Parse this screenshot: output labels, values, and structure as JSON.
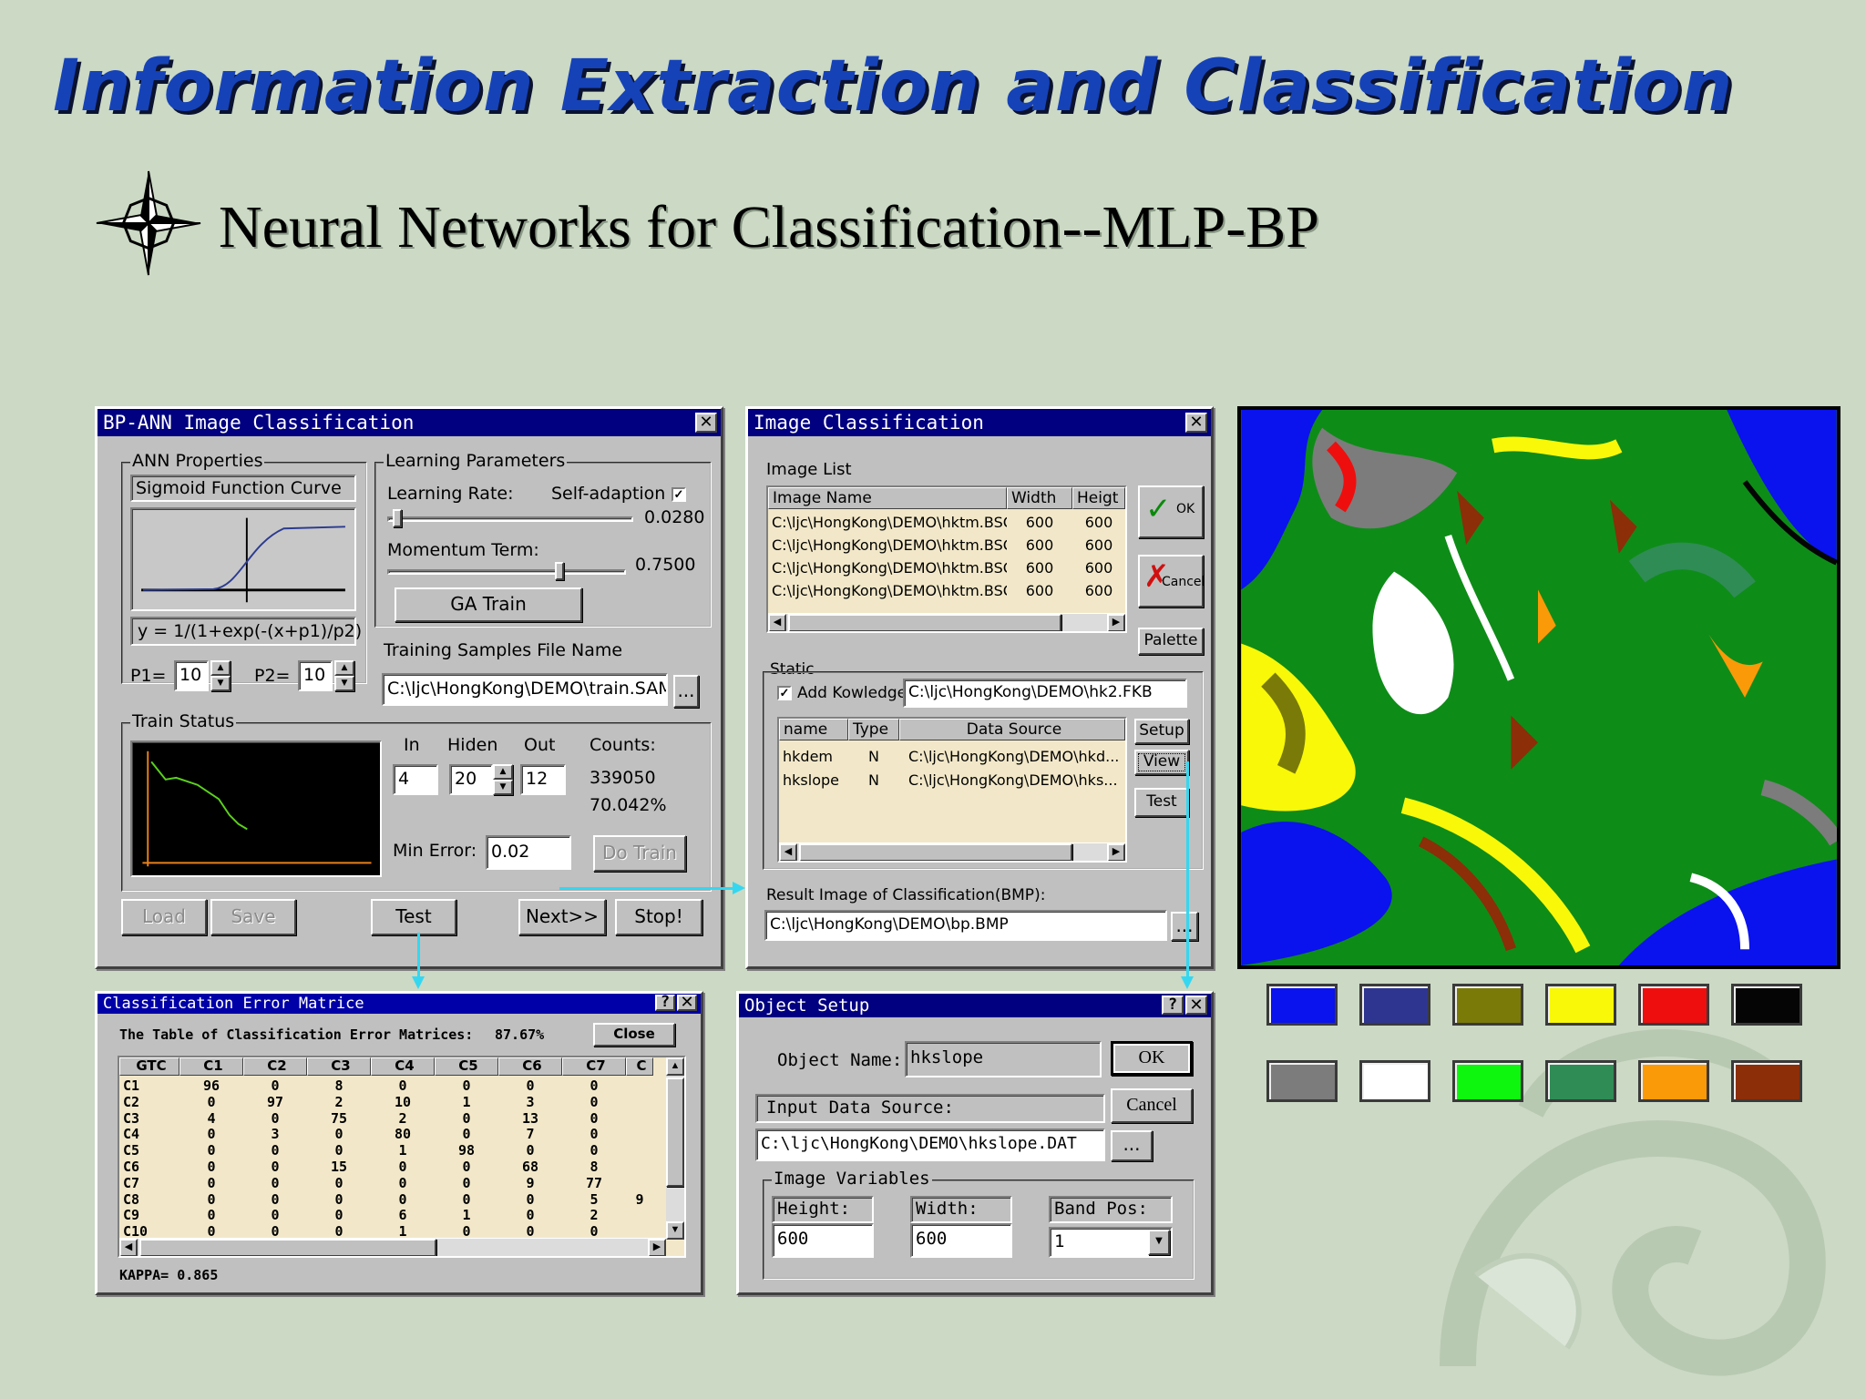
{
  "slide": {
    "title": "Information Extraction and Classification",
    "subtitle": "Neural Networks for Classification--MLP-BP"
  },
  "bp_ann": {
    "title": "BP-ANN Image Classification",
    "ann_properties": "ANN Properties",
    "sigmoid_curve": "Sigmoid Function Curve",
    "formula": "y = 1/(1+exp(-(x+p1)/p2)",
    "p1_label": "P1=",
    "p1_value": "10",
    "p2_label": "P2=",
    "p2_value": "10",
    "learning_params": "Learning Parameters",
    "learning_rate_label": "Learning Rate:",
    "self_adaption": "Self-adaption",
    "learning_rate_value": "0.0280",
    "momentum_label": "Momentum Term:",
    "momentum_value": "0.7500",
    "ga_train": "GA Train",
    "training_file_label": "Training Samples File Name",
    "training_file": "C:\\ljc\\HongKong\\DEMO\\train.SAM",
    "browse": "...",
    "train_status": "Train Status",
    "in_label": "In",
    "hiden_label": "Hiden",
    "out_label": "Out",
    "counts_label": "Counts:",
    "in_value": "4",
    "hiden_value": "20",
    "out_value": "12",
    "counts_value": "339050",
    "percent_value": "70.042%",
    "min_error_label": "Min Error:",
    "min_error_value": "0.02",
    "do_train": "Do Train",
    "load": "Load",
    "save": "Save",
    "test": "Test",
    "next": "Next>>",
    "stop": "Stop!"
  },
  "image_classification": {
    "title": "Image Classification",
    "image_list": "Image List",
    "columns": [
      "Image Name",
      "Width",
      "Heigt"
    ],
    "rows": [
      [
        "C:\\ljc\\HongKong\\DEMO\\hktm.BSQ",
        "600",
        "600"
      ],
      [
        "C:\\ljc\\HongKong\\DEMO\\hktm.BSQ",
        "600",
        "600"
      ],
      [
        "C:\\ljc\\HongKong\\DEMO\\hktm.BSQ",
        "600",
        "600"
      ],
      [
        "C:\\ljc\\HongKong\\DEMO\\hktm.BSQ",
        "600",
        "600"
      ]
    ],
    "ok": "OK",
    "cancel": "Cancel",
    "palette": "Palette",
    "static": "Static",
    "add_knowledge": "Add Kowledge",
    "knowledge_file": "C:\\ljc\\HongKong\\DEMO\\hk2.FKB",
    "k_columns": [
      "name",
      "Type",
      "Data Source"
    ],
    "k_rows": [
      [
        "hkdem",
        "N",
        "C:\\ljc\\HongKong\\DEMO\\hkd..."
      ],
      [
        "hkslope",
        "N",
        "C:\\ljc\\HongKong\\DEMO\\hks..."
      ]
    ],
    "setup": "Setup",
    "view": "View",
    "test": "Test",
    "result_label": "Result Image of Classification(BMP):",
    "result_file": "C:\\ljc\\HongKong\\DEMO\\bp.BMP",
    "browse": "..."
  },
  "error_matrix": {
    "title": "Classification Error Matrice",
    "table_caption": "The Table of Classification Error Matrices:",
    "accuracy": "87.67%",
    "close": "Close",
    "columns": [
      "GTC",
      "C1",
      "C2",
      "C3",
      "C4",
      "C5",
      "C6",
      "C7",
      "C"
    ],
    "rows": [
      [
        "C1",
        "96",
        "0",
        "8",
        "0",
        "0",
        "0",
        "0",
        ""
      ],
      [
        "C2",
        "0",
        "97",
        "2",
        "10",
        "1",
        "3",
        "0",
        ""
      ],
      [
        "C3",
        "4",
        "0",
        "75",
        "2",
        "0",
        "13",
        "0",
        ""
      ],
      [
        "C4",
        "0",
        "3",
        "0",
        "80",
        "0",
        "7",
        "0",
        ""
      ],
      [
        "C5",
        "0",
        "0",
        "0",
        "1",
        "98",
        "0",
        "0",
        ""
      ],
      [
        "C6",
        "0",
        "0",
        "15",
        "0",
        "0",
        "68",
        "8",
        ""
      ],
      [
        "C7",
        "0",
        "0",
        "0",
        "0",
        "0",
        "9",
        "77",
        ""
      ],
      [
        "C8",
        "0",
        "0",
        "0",
        "0",
        "0",
        "0",
        "5",
        "9"
      ],
      [
        "C9",
        "0",
        "0",
        "0",
        "6",
        "1",
        "0",
        "2",
        ""
      ],
      [
        "C10",
        "0",
        "0",
        "0",
        "1",
        "0",
        "0",
        "0",
        ""
      ]
    ],
    "kappa": "KAPPA= 0.865"
  },
  "object_setup": {
    "title": "Object Setup",
    "object_name_label": "Object Name:",
    "object_name": "hkslope",
    "ok": "OK",
    "cancel": "Cancel",
    "input_source_label": "Input Data Source:",
    "input_source": "C:\\ljc\\HongKong\\DEMO\\hkslope.DAT",
    "browse": "...",
    "image_variables": "Image Variables",
    "height_label": "Height:",
    "height": "600",
    "width_label": "Width:",
    "width": "600",
    "band_label": "Band Pos:",
    "band": "1"
  },
  "legend_colors": [
    "#0a12ee",
    "#2e3590",
    "#7a7a08",
    "#f8f808",
    "#ef0e0e",
    "#050505",
    "#7c7c7c",
    "#ffffff",
    "#0ef50e",
    "#2f8c55",
    "#fa9a08",
    "#8c2e08"
  ],
  "icons": [
    "compass-star-icon",
    "close-icon",
    "help-icon",
    "check-icon",
    "x-icon",
    "spin-up-icon",
    "spin-down-icon",
    "dropdown-arrow-icon"
  ]
}
